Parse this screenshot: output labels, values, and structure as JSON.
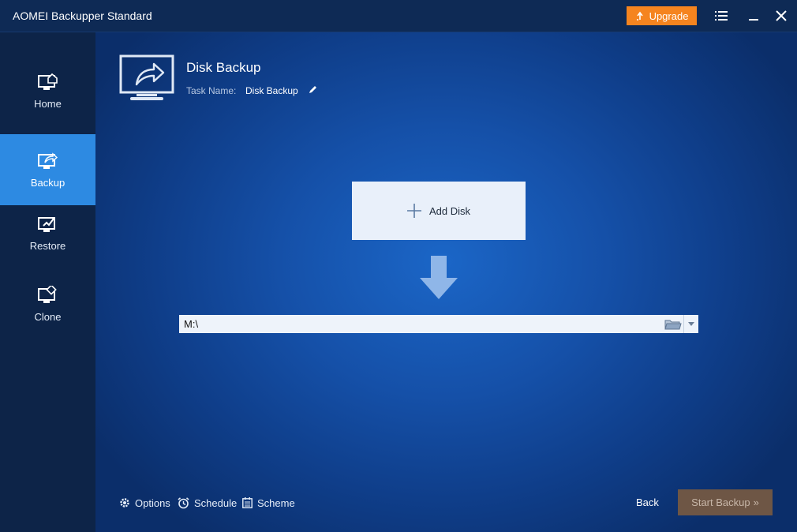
{
  "window": {
    "title": "AOMEI Backupper Standard"
  },
  "toolbar": {
    "upgrade_label": "Upgrade"
  },
  "sidebar": {
    "items": [
      {
        "label": "Home"
      },
      {
        "label": "Backup"
      },
      {
        "label": "Restore"
      },
      {
        "label": "Clone"
      }
    ],
    "active": "Backup"
  },
  "header": {
    "title": "Disk Backup",
    "task_name_label": "Task Name:",
    "task_name_value": "Disk Backup"
  },
  "source": {
    "add_disk_label": "Add Disk"
  },
  "destination": {
    "path": "M:\\"
  },
  "footer": {
    "options_label": "Options",
    "schedule_label": "Schedule",
    "scheme_label": "Scheme",
    "back_label": "Back",
    "start_label": "Start Backup",
    "start_chevron": "»"
  },
  "colors": {
    "accent": "#2d8ae2",
    "upgrade": "#f5841f",
    "start_disabled": "#6e5645"
  }
}
